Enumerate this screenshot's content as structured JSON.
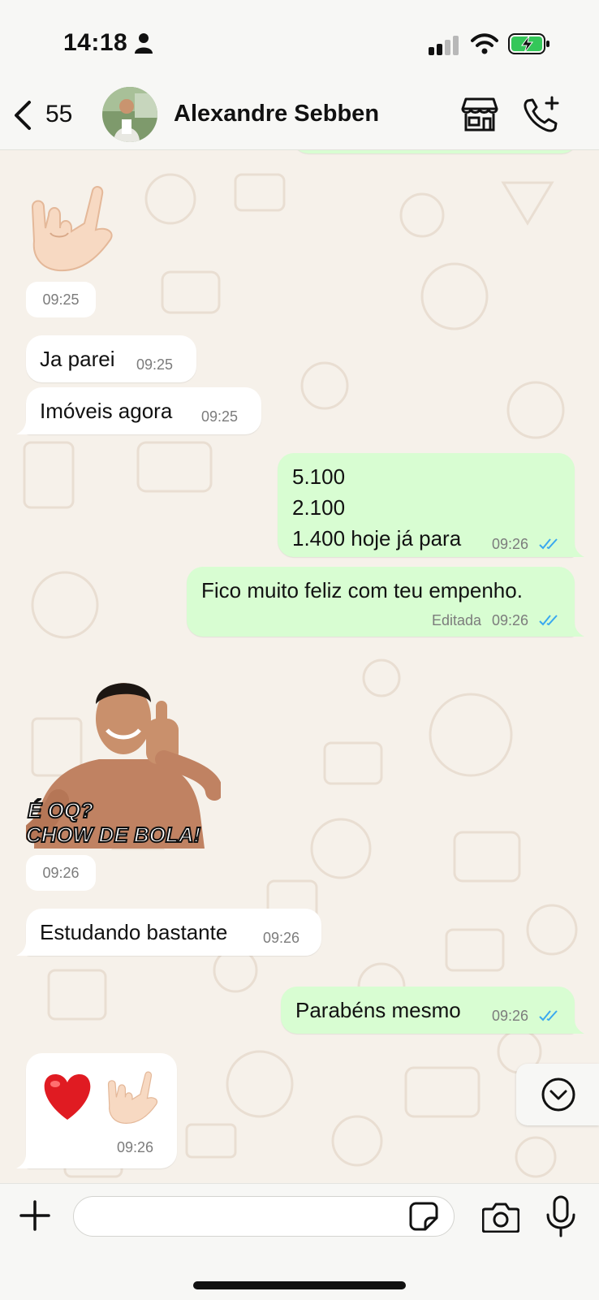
{
  "status_bar": {
    "time": "14:18"
  },
  "header": {
    "back_count": "55",
    "contact_name": "Alexandre Sebben"
  },
  "colors": {
    "outgoing_bubble": "#d8fdd2",
    "incoming_bubble": "#ffffff",
    "read_ticks": "#3aa8ef",
    "wallpaper": "#f6f1ea"
  },
  "messages": [
    {
      "direction": "in",
      "type": "sticker",
      "icon": "love-you-gesture-emoji",
      "time": "09:25"
    },
    {
      "direction": "in",
      "type": "text",
      "text": "Ja parei",
      "time": "09:25"
    },
    {
      "direction": "in",
      "type": "text",
      "text": "Imóveis agora",
      "time": "09:25"
    },
    {
      "direction": "out",
      "type": "text",
      "lines": [
        "5.100",
        "2.100",
        "1.400 hoje já para"
      ],
      "time": "09:26",
      "status": "read"
    },
    {
      "direction": "out",
      "type": "text",
      "text": "Fico muito feliz com teu empenho.",
      "edited_label": "Editada",
      "time": "09:26",
      "status": "read"
    },
    {
      "direction": "in",
      "type": "sticker",
      "icon": "thumbs-up-man-sticker",
      "sticker_text": [
        "É OQ?",
        "CHOW DE BOLA!"
      ],
      "time": "09:26"
    },
    {
      "direction": "in",
      "type": "text",
      "text": "Estudando bastante",
      "time": "09:26"
    },
    {
      "direction": "out",
      "type": "text",
      "text": "Parabéns mesmo",
      "time": "09:26",
      "status": "read"
    },
    {
      "direction": "in",
      "type": "emoji",
      "icons": [
        "red-heart-emoji",
        "love-you-gesture-emoji"
      ],
      "time": "09:26"
    }
  ],
  "composer": {
    "placeholder": ""
  }
}
